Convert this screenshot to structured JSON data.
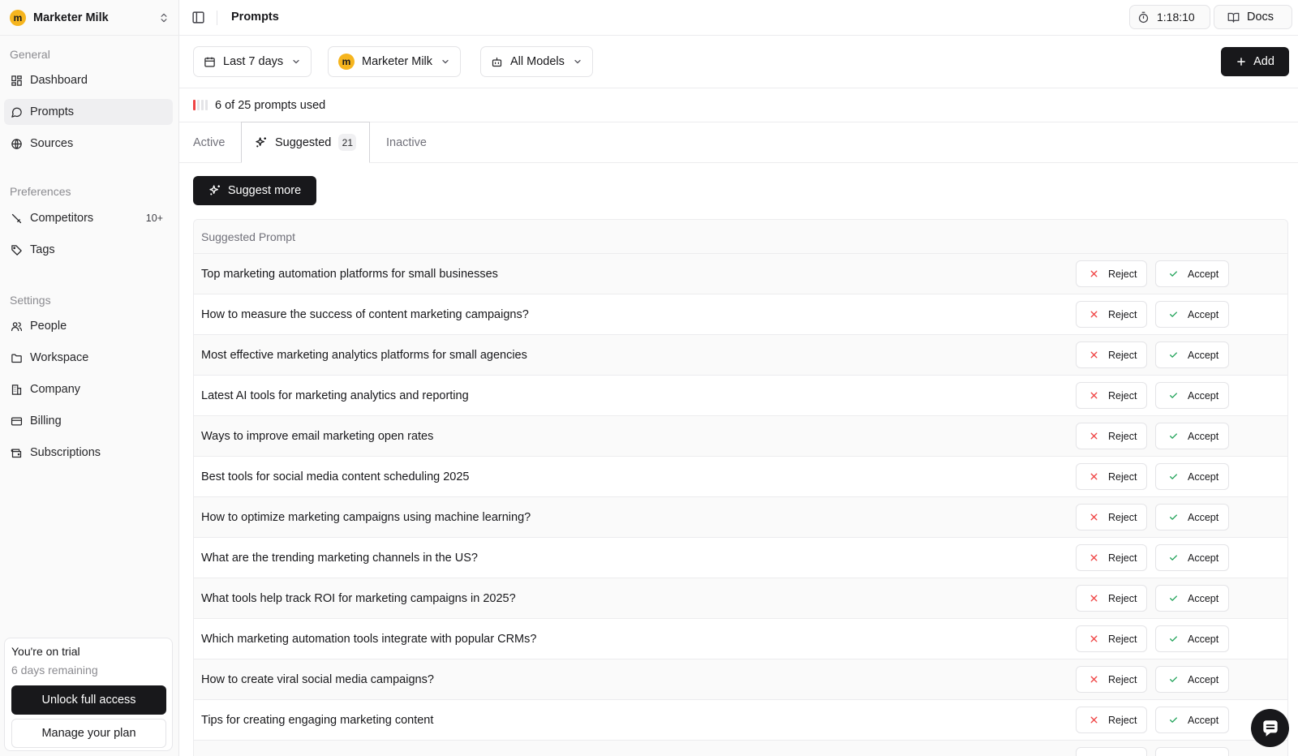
{
  "workspace": {
    "logo_letter": "m",
    "name": "Marketer Milk",
    "logo_color": "#f6b51e"
  },
  "sidebar": {
    "general_label": "General",
    "general": [
      {
        "label": "Dashboard",
        "icon": "dashboard-icon"
      },
      {
        "label": "Prompts",
        "icon": "message-circle-icon",
        "active": true
      },
      {
        "label": "Sources",
        "icon": "globe-icon"
      }
    ],
    "preferences_label": "Preferences",
    "preferences": [
      {
        "label": "Competitors",
        "icon": "sword-icon",
        "count": "10+"
      },
      {
        "label": "Tags",
        "icon": "tag-icon"
      }
    ],
    "settings_label": "Settings",
    "settings": [
      {
        "label": "People",
        "icon": "users-icon"
      },
      {
        "label": "Workspace",
        "icon": "folder-icon"
      },
      {
        "label": "Company",
        "icon": "building-icon"
      },
      {
        "label": "Billing",
        "icon": "credit-card-icon"
      },
      {
        "label": "Subscriptions",
        "icon": "wallet-icon"
      }
    ],
    "trial": {
      "title": "You're on trial",
      "remaining": "6 days remaining",
      "unlock_label": "Unlock full access",
      "manage_label": "Manage your plan"
    }
  },
  "header": {
    "title": "Prompts",
    "timer": "1:18:10",
    "docs_label": "Docs"
  },
  "filters": {
    "date_range": "Last 7 days",
    "brand": "Marketer Milk",
    "models": "All Models",
    "add_label": "Add"
  },
  "usage": {
    "text": "6 of 25 prompts used",
    "used": 6,
    "total": 25,
    "accent": "#ef4444"
  },
  "tabs": [
    {
      "label": "Active"
    },
    {
      "label": "Suggested",
      "count": "21",
      "active": true
    },
    {
      "label": "Inactive"
    }
  ],
  "suggest_more_label": "Suggest more",
  "table": {
    "header": "Suggested Prompt",
    "reject_label": "Reject",
    "accept_label": "Accept",
    "reject_color": "#ef4444",
    "accept_color": "#22a35a",
    "rows": [
      "Top marketing automation platforms for small businesses",
      "How to measure the success of content marketing campaigns?",
      "Most effective marketing analytics platforms for small agencies",
      "Latest AI tools for marketing analytics and reporting",
      "Ways to improve email marketing open rates",
      "Best tools for social media content scheduling 2025",
      "How to optimize marketing campaigns using machine learning?",
      "What are the trending marketing channels in the US?",
      "What tools help track ROI for marketing campaigns in 2025?",
      "Which marketing automation tools integrate with popular CRMs?",
      "How to create viral social media campaigns?",
      "Tips for creating engaging marketing content",
      ""
    ]
  }
}
